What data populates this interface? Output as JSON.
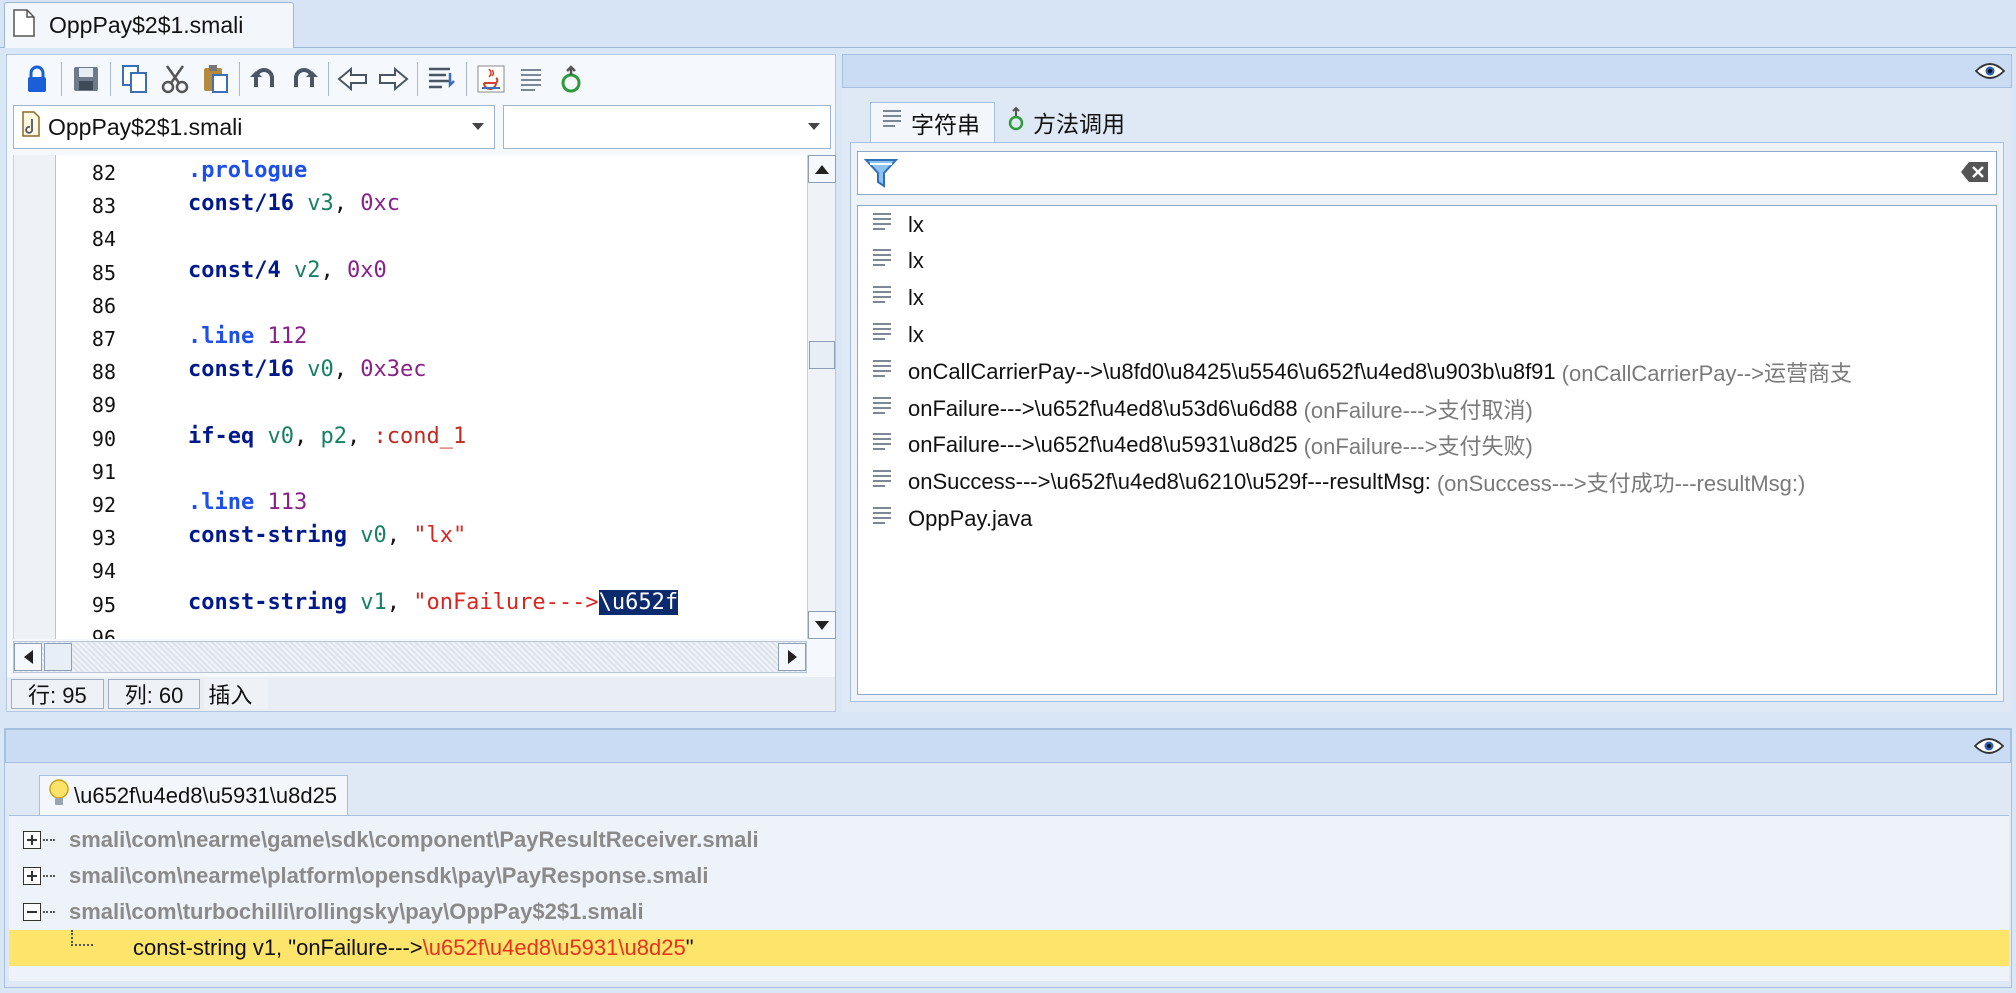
{
  "file_tab": {
    "title": "OppPay$2$1.smali"
  },
  "editor": {
    "file_combo_value": "OppPay$2$1.smali",
    "second_combo_value": "",
    "lines": [
      {
        "n": "82",
        "tokens": [
          {
            "t": ".prologue",
            "c": "dir"
          }
        ]
      },
      {
        "n": "83",
        "tokens": [
          {
            "t": "const/16",
            "c": "kw"
          },
          {
            "t": " "
          },
          {
            "t": "v3",
            "c": "reg"
          },
          {
            "t": ", "
          },
          {
            "t": "0xc",
            "c": "num"
          }
        ]
      },
      {
        "n": "84",
        "tokens": []
      },
      {
        "n": "85",
        "tokens": [
          {
            "t": "const/4",
            "c": "kw"
          },
          {
            "t": " "
          },
          {
            "t": "v2",
            "c": "reg"
          },
          {
            "t": ", "
          },
          {
            "t": "0x0",
            "c": "num"
          }
        ]
      },
      {
        "n": "86",
        "tokens": []
      },
      {
        "n": "87",
        "tokens": [
          {
            "t": ".line",
            "c": "dir"
          },
          {
            "t": " "
          },
          {
            "t": "112",
            "c": "num"
          }
        ]
      },
      {
        "n": "88",
        "tokens": [
          {
            "t": "const/16",
            "c": "kw"
          },
          {
            "t": " "
          },
          {
            "t": "v0",
            "c": "reg"
          },
          {
            "t": ", "
          },
          {
            "t": "0x3ec",
            "c": "num"
          }
        ]
      },
      {
        "n": "89",
        "tokens": []
      },
      {
        "n": "90",
        "tokens": [
          {
            "t": "if-eq",
            "c": "kw"
          },
          {
            "t": " "
          },
          {
            "t": "v0",
            "c": "reg"
          },
          {
            "t": ", "
          },
          {
            "t": "p2",
            "c": "reg"
          },
          {
            "t": ", "
          },
          {
            "t": ":cond_1",
            "c": "lbl"
          }
        ]
      },
      {
        "n": "91",
        "tokens": []
      },
      {
        "n": "92",
        "tokens": [
          {
            "t": ".line",
            "c": "dir"
          },
          {
            "t": " "
          },
          {
            "t": "113",
            "c": "num"
          }
        ]
      },
      {
        "n": "93",
        "tokens": [
          {
            "t": "const-string",
            "c": "kw"
          },
          {
            "t": " "
          },
          {
            "t": "v0",
            "c": "reg"
          },
          {
            "t": ", "
          },
          {
            "t": "\"lx\"",
            "c": "str"
          }
        ]
      },
      {
        "n": "94",
        "tokens": []
      },
      {
        "n": "95",
        "tokens": [
          {
            "t": "const-string",
            "c": "kw"
          },
          {
            "t": " "
          },
          {
            "t": "v1",
            "c": "reg"
          },
          {
            "t": ", "
          },
          {
            "t": "\"onFailure--->",
            "c": "str"
          },
          {
            "t": "\\u652f",
            "c": "sel"
          }
        ]
      },
      {
        "n": "96",
        "tokens": []
      }
    ]
  },
  "status": {
    "row": "行: 95",
    "col": "列: 60",
    "mode": "插入"
  },
  "right_panel": {
    "tabs": [
      {
        "label": "字符串",
        "icon": "lines-icon",
        "active": true
      },
      {
        "label": "方法调用",
        "icon": "method-call-icon",
        "active": false
      }
    ],
    "filter_value": "",
    "strings": [
      {
        "main": "lx",
        "sub": ""
      },
      {
        "main": "lx",
        "sub": ""
      },
      {
        "main": "lx",
        "sub": ""
      },
      {
        "main": "lx",
        "sub": ""
      },
      {
        "main": "onCallCarrierPay-->\\u8fd0\\u8425\\u5546\\u652f\\u4ed8\\u903b\\u8f91",
        "sub": "(onCallCarrierPay-->运营商支"
      },
      {
        "main": "onFailure--->\\u652f\\u4ed8\\u53d6\\u6d88",
        "sub": "(onFailure--->支付取消)"
      },
      {
        "main": "onFailure--->\\u652f\\u4ed8\\u5931\\u8d25",
        "sub": "(onFailure--->支付失败)"
      },
      {
        "main": "onSuccess--->\\u652f\\u4ed8\\u6210\\u529f---resultMsg:",
        "sub": "(onSuccess--->支付成功---resultMsg:)"
      },
      {
        "main": "OppPay.java",
        "sub": ""
      }
    ]
  },
  "bottom_panel": {
    "search_tab": "\\u652f\\u4ed8\\u5931\\u8d25",
    "tree": [
      {
        "path": "smali\\com\\nearme\\game\\sdk\\component\\PayResultReceiver.smali",
        "expanded": false
      },
      {
        "path": "smali\\com\\nearme\\platform\\opensdk\\pay\\PayResponse.smali",
        "expanded": false
      },
      {
        "path": "smali\\com\\turbochilli\\rollingsky\\pay\\OppPay$2$1.smali",
        "expanded": true
      }
    ],
    "result": {
      "prefix": "const-string v1, \"onFailure--->",
      "highlight": "\\u652f\\u4ed8\\u5931\\u8d25",
      "suffix": "\""
    }
  },
  "colors": {
    "selection": "#0c2a6e",
    "result_highlight_bg": "#fde46b",
    "result_highlight_text": "#e8321e",
    "panel_header": "#c9dcf4"
  }
}
